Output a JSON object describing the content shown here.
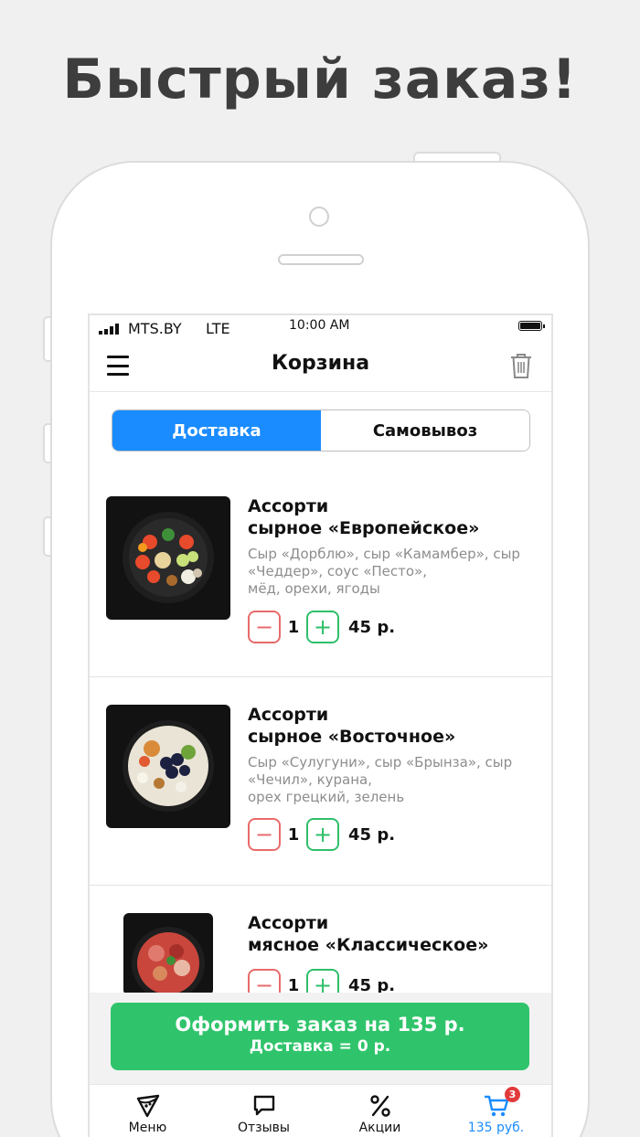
{
  "headline": "Быстрый заказ!",
  "status_bar": {
    "carrier": "MTS.BY",
    "network": "LTE",
    "time": "10:00 AM"
  },
  "nav": {
    "title": "Корзина"
  },
  "delivery_toggle": {
    "delivery": "Доставка",
    "pickup": "Самовывоз",
    "selected": "Доставка"
  },
  "cart_items": [
    {
      "title_line1": "Ассорти",
      "title_line2": "сырное «Европейское»",
      "desc_line1": "Сыр «Дорблю», сыр «Камамбер», сыр",
      "desc_line2": "«Чеддер», соус «Песто»,",
      "desc_line3": "мёд, орехи, ягоды",
      "minus": "−",
      "plus": "+",
      "quantity": "1",
      "price": "45 р."
    },
    {
      "title_line1": "Ассорти",
      "title_line2": "сырное «Восточное»",
      "desc_line1": "Сыр «Сулугуни», сыр «Брынза», сыр",
      "desc_line2": "«Чечил», курана,",
      "desc_line3": "орех грецкий, зелень",
      "minus": "−",
      "plus": "+",
      "quantity": "1",
      "price": "45 р."
    },
    {
      "title_line1": "Ассорти",
      "title_line2": "мясное «Классическое»",
      "minus": "−",
      "plus": "+",
      "quantity": "1",
      "price": "45 р."
    }
  ],
  "checkout": {
    "label": "Оформить заказ на 135 р.",
    "delivery_note": "Доставка = 0 р."
  },
  "tabbar": {
    "menu": "Меню",
    "reviews": "Отзывы",
    "promos": "Акции",
    "cart": "135 руб.",
    "cart_badge": "3"
  },
  "colors": {
    "accent": "#1a8cff",
    "checkout": "#2fc46b",
    "minus": "#e86b6b",
    "plus": "#2fbf6a",
    "badge": "#e23b3b"
  },
  "icons": [
    "hamburger-icon",
    "trash-icon",
    "pizza-slice-icon",
    "chat-bubble-icon",
    "percent-icon",
    "cart-icon"
  ]
}
